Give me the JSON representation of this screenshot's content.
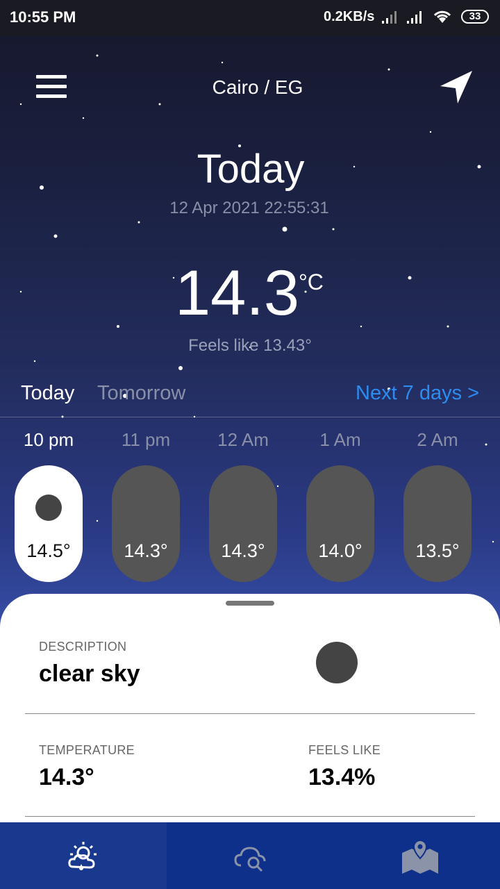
{
  "status_bar": {
    "time": "10:55 PM",
    "net_speed": "0.2KB/s",
    "battery": "33"
  },
  "header": {
    "menu_icon": "hamburger-menu-icon",
    "city": "Cairo / EG",
    "location_icon": "navigation-arrow-icon"
  },
  "current": {
    "title": "Today",
    "datetime": "12 Apr 2021 22:55:31",
    "temperature": "14.3",
    "unit": "°C",
    "feels_like": "Feels like 13.43°"
  },
  "tabs": {
    "today": "Today",
    "tomorrow": "Tomorrow",
    "next": "Next 7 days >"
  },
  "hourly": [
    {
      "time": "10 pm",
      "temp": "14.5°",
      "icon": "moon-icon",
      "active": true
    },
    {
      "time": "11 pm",
      "temp": "14.3°",
      "icon": "moon-icon",
      "active": false
    },
    {
      "time": "12 Am",
      "temp": "14.3°",
      "icon": "moon-icon",
      "active": false
    },
    {
      "time": "1 Am",
      "temp": "14.0°",
      "icon": "moon-icon",
      "active": false
    },
    {
      "time": "2 Am",
      "temp": "13.5°",
      "icon": "moon-icon",
      "active": false
    }
  ],
  "details": {
    "description_label": "DESCRIPTION",
    "description": "clear sky",
    "temperature_label": "TEMPERATURE",
    "temperature": "14.3°",
    "feels_label": "FEELS LIKE",
    "feels": "13.4%"
  },
  "nav": {
    "items": [
      "weather-icon",
      "search-weather-icon",
      "map-icon"
    ]
  },
  "colors": {
    "accent": "#2d8cf0",
    "nav_bg": "#0e2f8a"
  }
}
